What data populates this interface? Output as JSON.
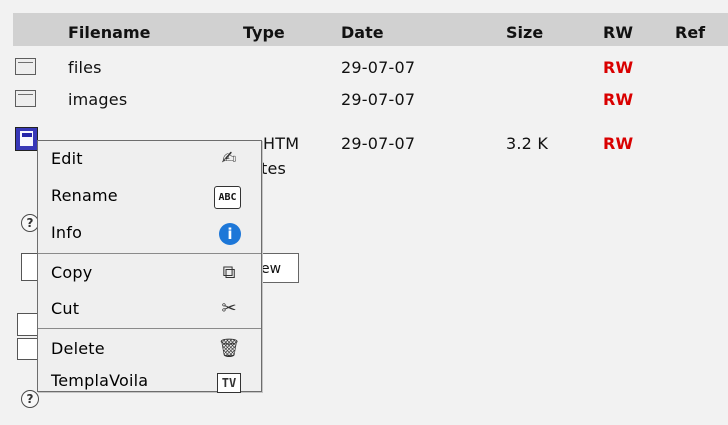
{
  "table": {
    "headers": {
      "filename": "Filename",
      "type": "Type",
      "date": "Date",
      "size": "Size",
      "rw": "RW",
      "ref": "Ref"
    },
    "rows": [
      {
        "name": "files",
        "type": "",
        "date": "29-07-07",
        "size": "",
        "rw": "RW"
      },
      {
        "name": "images",
        "type": "",
        "date": "29-07-07",
        "size": "",
        "rw": "RW"
      },
      {
        "name": "",
        "type": "HTM",
        "type_extra": "tes",
        "date": "29-07-07",
        "size": "3.2 K",
        "rw": "RW"
      }
    ]
  },
  "underlying": {
    "button_label": "ew",
    "help_symbol": "?"
  },
  "context_menu": {
    "items": [
      {
        "label": "Edit",
        "icon": "edit-icon",
        "glyph": "✍"
      },
      {
        "label": "Rename",
        "icon": "rename-icon",
        "glyph": "ABC"
      },
      {
        "label": "Info",
        "icon": "info-icon",
        "glyph": "i"
      },
      {
        "label": "Copy",
        "icon": "copy-icon",
        "glyph": "⧉"
      },
      {
        "label": "Cut",
        "icon": "cut-icon",
        "glyph": "✂"
      },
      {
        "label": "Delete",
        "icon": "delete-icon",
        "glyph": "🗑"
      },
      {
        "label": "TemplaVoila",
        "icon": "templavoila-icon",
        "glyph": "TV"
      }
    ]
  },
  "colors": {
    "header_background": "#d1d1d1",
    "page_background": "#f2f2f2",
    "rw_red": "#d90000",
    "menu_background": "#efefef",
    "info_blue": "#1d77d8"
  }
}
